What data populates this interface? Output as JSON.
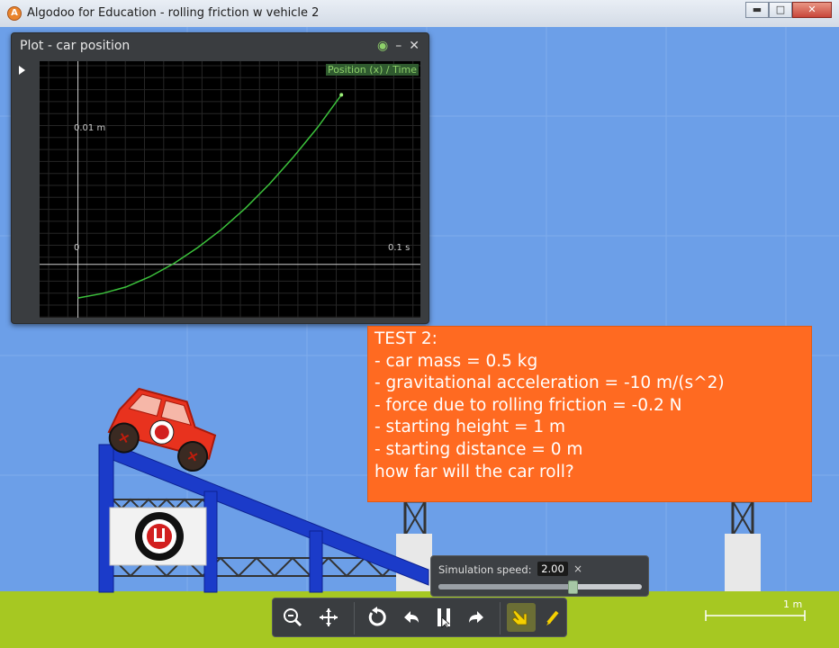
{
  "window": {
    "title": "Algodoo for Education - rolling friction w vehicle 2",
    "app_icon": "algodoo-logo-icon",
    "buttons": {
      "minimize": "▬",
      "maximize": "□",
      "close": "✕"
    }
  },
  "plot": {
    "title": "Plot - car position",
    "header_icons": [
      "eye-icon",
      "minimize-icon",
      "close-icon"
    ],
    "legend": "Position (x) / Time",
    "y_tick_label": "0.01 m",
    "origin_label": "0",
    "x_tick_label": "0.1 s",
    "curve_color": "#3cc23c"
  },
  "chart_data": {
    "type": "line",
    "xlabel": "",
    "ylabel": "",
    "series": [
      {
        "x": [
          0.0,
          0.01,
          0.02,
          0.03,
          0.04,
          0.05,
          0.06,
          0.07,
          0.08,
          0.09,
          0.1,
          0.11
        ],
        "y": [
          -0.0046,
          -0.004,
          -0.0031,
          -0.0017,
          0.0001,
          0.0023,
          0.0048,
          0.0077,
          0.011,
          0.0147,
          0.0187,
          0.0232
        ]
      }
    ],
    "xlim": [
      -0.016,
      0.143
    ],
    "ylim": [
      -0.0073,
      0.0278
    ],
    "grid": true
  },
  "info": {
    "lines": [
      "TEST 2:",
      "- car mass = 0.5 kg",
      "- gravitational acceleration = -10 m/(s^2)",
      "- force due to rolling friction = -0.2 N",
      "- starting height = 1 m",
      "- starting distance = 0 m",
      "",
      "how far will the car roll?"
    ],
    "background": "#ff6a21"
  },
  "simulation": {
    "label": "Simulation speed:",
    "value": "2.00",
    "close": "×",
    "slider_fraction": 0.66
  },
  "toolbar": {
    "tools": [
      "zoom-icon",
      "pan-icon",
      "reset-icon",
      "undo-icon",
      "play-pause-icon",
      "redo-icon",
      "hand-tool-icon",
      "brush-tool-icon"
    ]
  },
  "scale": {
    "label": "1 m"
  },
  "colors": {
    "sky": "#6c9fe8",
    "ground": "#a6c822",
    "ramp": "#1b3bc9",
    "car": "#e8321e"
  }
}
